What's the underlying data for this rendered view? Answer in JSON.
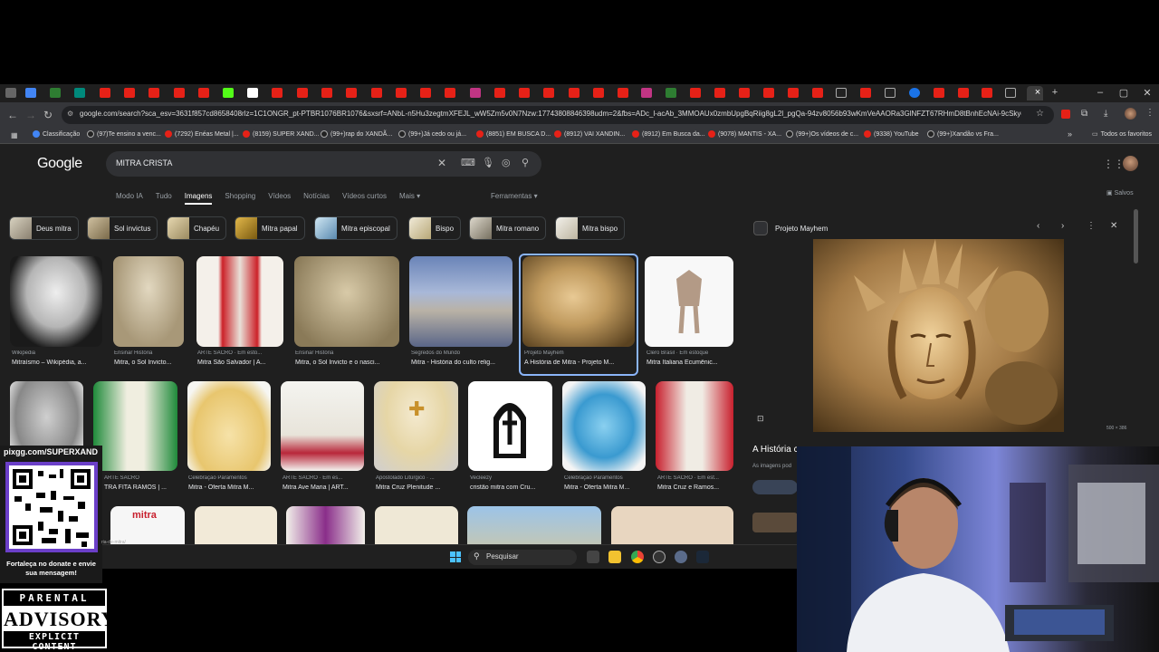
{
  "browser": {
    "url": "google.com/search?sca_esv=3631f857cd8658408rlz=1C1ONGR_pt-PTBR1076BR1076&sxsrf=ANbL-n5Hu3zegtmXFEJL_wW5Zm5v0N7Nzw:17743808846398udm=2&fbs=ADc_l-acAb_3MMOAUx0zmbUpgBqRiig8gL2l_pgQa-94zv8056b93wKmVeAAORa3GlNFZT67RHmD8tBnhEcNAi-9cSkygcRso6EAAP-m...",
    "all_bookmarks_label": "Todos os favoritos",
    "bookmarks": [
      {
        "label": "Classificação"
      },
      {
        "label": "(97)Te ensino a venc..."
      },
      {
        "label": "(7292) Enéas Metal |..."
      },
      {
        "label": "(8159) SUPER XAND..."
      },
      {
        "label": "(99+)rap do XANDÃ..."
      },
      {
        "label": "(99+)Já cedo ou já..."
      },
      {
        "label": "(8851) EM BUSCA D..."
      },
      {
        "label": "(8912) VAI XANDIN..."
      },
      {
        "label": "(8912) Em Busca da..."
      },
      {
        "label": "(9078) MANTIS - XA..."
      },
      {
        "label": "(99+)Os vídeos de c..."
      },
      {
        "label": "(9338) YouTube"
      },
      {
        "label": "(99+)Xandão vs Fra..."
      }
    ]
  },
  "google": {
    "logo": "Google",
    "query": "MITRA CRISTA",
    "menus": [
      "Modo IA",
      "Tudo",
      "Imagens",
      "Shopping",
      "Vídeos",
      "Notícias",
      "Vídeos curtos",
      "Mais ▾"
    ],
    "tools": "Ferramentas ▾",
    "saved": "Salvos",
    "chips": [
      "Deus mitra",
      "Sol invictus",
      "Chapéu",
      "Mitra papal",
      "Mitra episcopal",
      "Bispo",
      "Mitra romano",
      "Mitra bispo"
    ],
    "row1": [
      {
        "source": "Wikipedia",
        "title": "Mitraísmo – Wikipédia, a..."
      },
      {
        "source": "Ensinar História",
        "title": "Mitra, o Sol Invicto..."
      },
      {
        "source": "ARTE SACRO · Em esto...",
        "title": "Mitra São Salvador | A..."
      },
      {
        "source": "Ensinar História",
        "title": "Mitra, o Sol Invicto e o nasci..."
      },
      {
        "source": "Segredos do Mundo",
        "title": "Mitra - História do culto relig..."
      },
      {
        "source": "Projeto Mayhem",
        "title": "A História de Mitra - Projeto M..."
      },
      {
        "source": "Clero Brasil · Em estoque",
        "title": "Mitra Italiana Ecumênic..."
      }
    ],
    "row2": [
      {
        "source": "",
        "title": ""
      },
      {
        "source": "ARTE SACRO",
        "title": "TRA FITA RAMOS | ..."
      },
      {
        "source": "Celebração Paramentos",
        "title": "Mitra - Oferta Mitra M..."
      },
      {
        "source": "ARTE SACRO · Em es...",
        "title": "Mitra Ave Maria | ART..."
      },
      {
        "source": "Apostolado Litúrgico · ...",
        "title": "Mitra Cruz Plenitude ..."
      },
      {
        "source": "Vecleezy",
        "title": "cristão mitra com Cru..."
      },
      {
        "source": "Celebração Paramentos",
        "title": "Mitra - Oferta Mitra M..."
      },
      {
        "source": "ARTE SACRO · Em est...",
        "title": "Mitra Cruz e Ramos..."
      }
    ],
    "row3_labels": {
      "mitra_box": "mitra",
      "url_fragment": "ria-de-mitra/"
    }
  },
  "preview": {
    "site": "Projeto Mayhem",
    "title": "A História c",
    "subtitle": "As imagens pod",
    "dims": "500 × 386"
  },
  "taskbar": {
    "search_placeholder": "Pesquisar"
  },
  "overlay": {
    "pix": "pixgg.com/SUPERXAND",
    "donate_msg": "Fortaleça no donate e envie sua mensagem!",
    "advisory_1": "PARENTAL",
    "advisory_2": "ADVISORY",
    "advisory_3": "EXPLICIT CONTENT"
  },
  "colors": {
    "accent": "#8ab4f8",
    "page_bg": "#1f1f1f",
    "youtube_red": "#e62117",
    "qr_border": "#6b3fc8"
  }
}
